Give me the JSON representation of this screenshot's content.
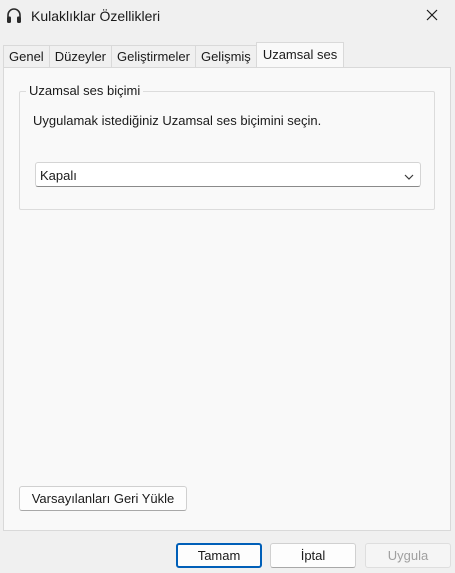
{
  "window": {
    "title": "Kulaklıklar Özellikleri",
    "icon": "headphones-icon"
  },
  "tabs": [
    {
      "label": "Genel",
      "active": false
    },
    {
      "label": "Düzeyler",
      "active": false
    },
    {
      "label": "Geliştirmeler",
      "active": false
    },
    {
      "label": "Gelişmiş",
      "active": false
    },
    {
      "label": "Uzamsal ses",
      "active": true
    }
  ],
  "spatial": {
    "group_label": "Uzamsal ses biçimi",
    "description": "Uygulamak istediğiniz Uzamsal ses biçimini seçin.",
    "format_selected": "Kapalı"
  },
  "buttons": {
    "restore_defaults": "Varsayılanları Geri Yükle",
    "ok": "Tamam",
    "cancel": "İptal",
    "apply": "Uygula"
  },
  "colors": {
    "accent": "#005fb8",
    "disabled_text": "#a0a0a0"
  }
}
